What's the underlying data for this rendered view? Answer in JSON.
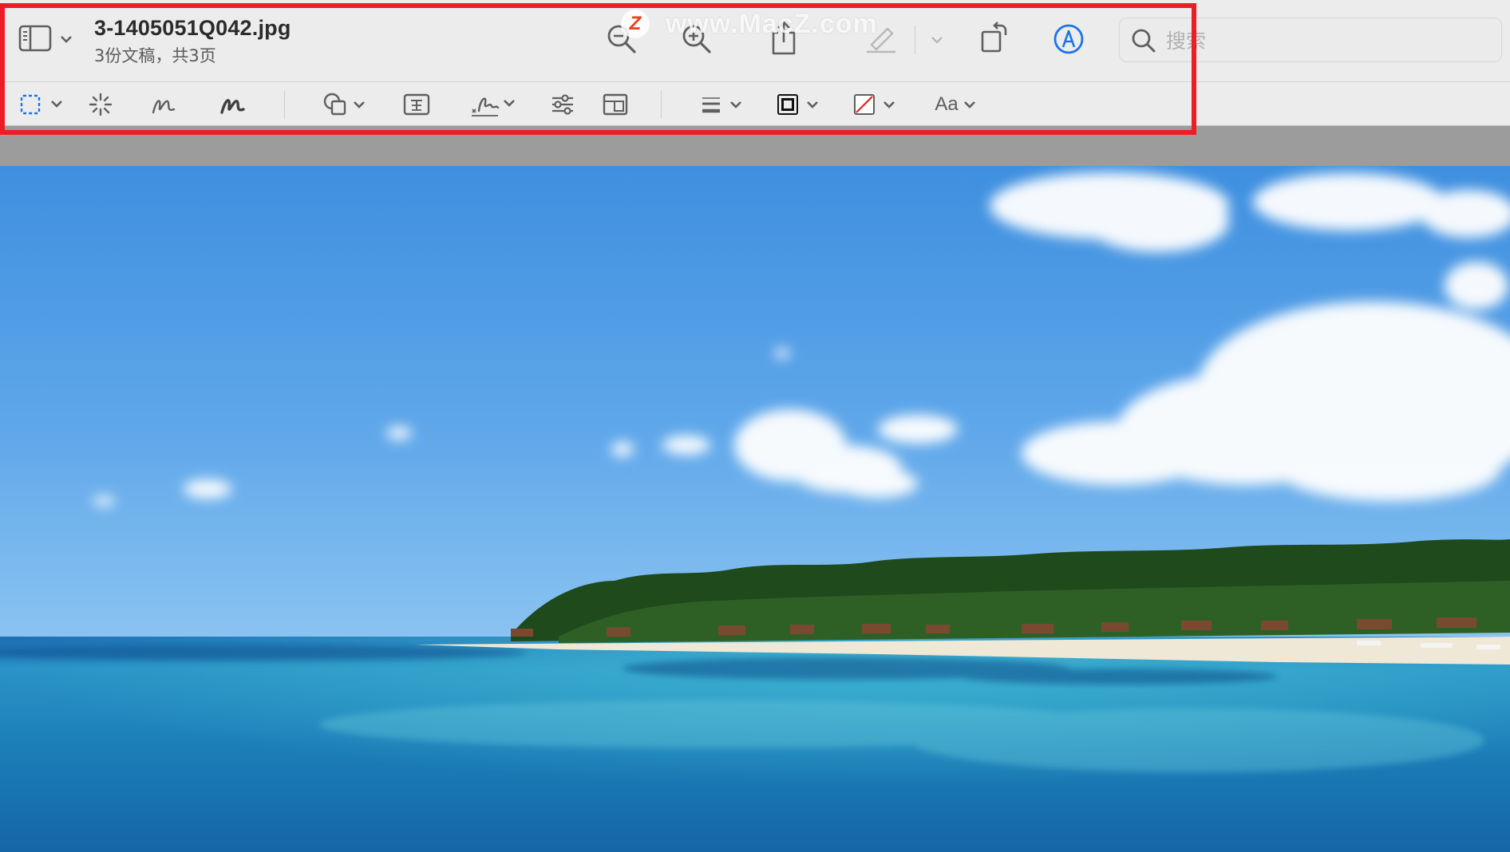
{
  "window": {
    "file_name": "3-1405051Q042.jpg",
    "subtitle": "3份文稿，共3页"
  },
  "search": {
    "placeholder": "搜索"
  },
  "watermark": {
    "text": "www.MacZ.com",
    "logo_letter": "Z"
  },
  "toolbar_row1": [
    {
      "name": "sidebar-toggle",
      "icon": "sidebar-icon"
    },
    {
      "name": "zoom-out",
      "icon": "zoom-out-icon"
    },
    {
      "name": "zoom-in",
      "icon": "zoom-in-icon"
    },
    {
      "name": "share",
      "icon": "share-icon"
    },
    {
      "name": "highlight",
      "icon": "highlighter-icon"
    },
    {
      "name": "rotate",
      "icon": "rotate-icon"
    },
    {
      "name": "markup",
      "icon": "markup-pen-circle-icon"
    }
  ],
  "toolbar_row2": [
    {
      "name": "rectangular-selection",
      "icon": "dashed-rect-icon"
    },
    {
      "name": "instant-alpha",
      "icon": "magic-wand-icon"
    },
    {
      "name": "sketch",
      "icon": "sketch-icon"
    },
    {
      "name": "draw",
      "icon": "draw-icon"
    },
    {
      "name": "shapes",
      "icon": "shapes-icon"
    },
    {
      "name": "text",
      "icon": "text-box-icon"
    },
    {
      "name": "sign",
      "icon": "signature-icon"
    },
    {
      "name": "adjust-color",
      "icon": "sliders-icon"
    },
    {
      "name": "adjust-size",
      "icon": "resize-icon"
    },
    {
      "name": "shape-style",
      "icon": "line-weight-icon"
    },
    {
      "name": "border-color",
      "icon": "border-color-icon"
    },
    {
      "name": "fill-color",
      "icon": "fill-color-icon"
    },
    {
      "name": "text-style",
      "icon": "text-style-icon",
      "label": "Aa"
    }
  ],
  "colors": {
    "highlight_frame": "#ee1c24",
    "markup_accent": "#1a73e8",
    "toolbar_bg": "#ececec",
    "canvas_gray": "#9c9c9c"
  }
}
